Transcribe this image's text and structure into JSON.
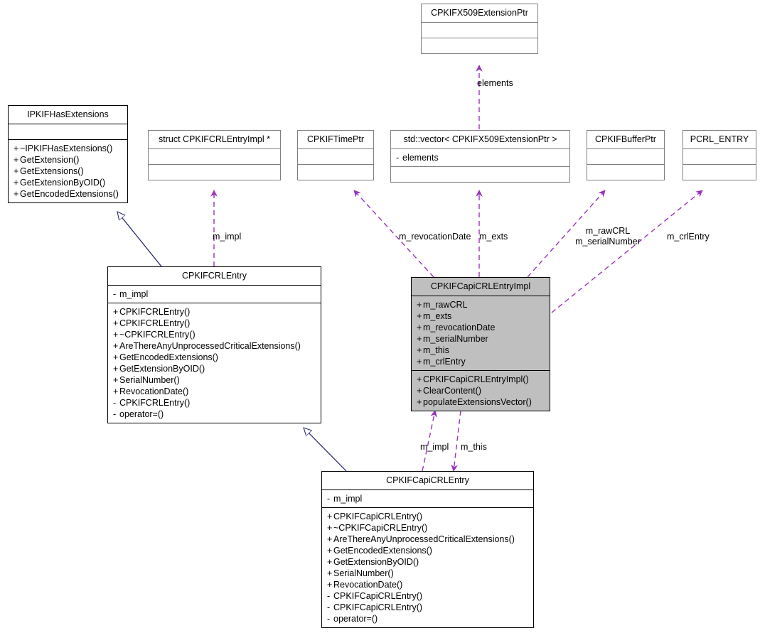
{
  "diagram": {
    "type": "uml-class-diagram",
    "colors": {
      "dependency_edge": "#9933bb",
      "inheritance_edge": "#191970",
      "highlight_fill": "#bfbfbf",
      "box_border": "#7f7f7f",
      "solid_border": "#000000",
      "background": "#ffffff"
    }
  },
  "classes": {
    "x509_extension_ptr": {
      "name": "CPKIFX509ExtensionPtr",
      "attributes": [],
      "operations": []
    },
    "ipkif_has_extensions": {
      "name": "IPKIFHasExtensions",
      "attributes": [],
      "operations": [
        {
          "vis": "+",
          "label": "~IPKIFHasExtensions()"
        },
        {
          "vis": "+",
          "label": "GetExtension()"
        },
        {
          "vis": "+",
          "label": "GetExtensions()"
        },
        {
          "vis": "+",
          "label": "GetExtensionByOID()"
        },
        {
          "vis": "+",
          "label": "GetEncodedExtensions()"
        }
      ]
    },
    "crl_entry_impl_struct": {
      "name": "struct CPKIFCRLEntryImpl *",
      "attributes": [],
      "operations": []
    },
    "time_ptr": {
      "name": "CPKIFTimePtr",
      "attributes": [],
      "operations": []
    },
    "vector_ext": {
      "name": "std::vector< CPKIFX509ExtensionPtr >",
      "attributes": [
        {
          "vis": "-",
          "label": "elements"
        }
      ],
      "operations": []
    },
    "buffer_ptr": {
      "name": "CPKIFBufferPtr",
      "attributes": [],
      "operations": []
    },
    "pcrl_entry": {
      "name": "PCRL_ENTRY",
      "attributes": [],
      "operations": []
    },
    "crl_entry": {
      "name": "CPKIFCRLEntry",
      "attributes": [
        {
          "vis": "-",
          "label": "m_impl"
        }
      ],
      "operations": [
        {
          "vis": "+",
          "label": "CPKIFCRLEntry()"
        },
        {
          "vis": "+",
          "label": "CPKIFCRLEntry()"
        },
        {
          "vis": "+",
          "label": "~CPKIFCRLEntry()"
        },
        {
          "vis": "+",
          "label": "AreThereAnyUnprocessedCriticalExtensions()"
        },
        {
          "vis": "+",
          "label": "GetEncodedExtensions()"
        },
        {
          "vis": "+",
          "label": "GetExtensionByOID()"
        },
        {
          "vis": "+",
          "label": "SerialNumber()"
        },
        {
          "vis": "+",
          "label": "RevocationDate()"
        },
        {
          "vis": "-",
          "label": "CPKIFCRLEntry()"
        },
        {
          "vis": "-",
          "label": "operator=()"
        }
      ]
    },
    "capi_crl_entry_impl": {
      "name": "CPKIFCapiCRLEntryImpl",
      "highlighted": true,
      "attributes": [
        {
          "vis": "+",
          "label": "m_rawCRL"
        },
        {
          "vis": "+",
          "label": "m_exts"
        },
        {
          "vis": "+",
          "label": "m_revocationDate"
        },
        {
          "vis": "+",
          "label": "m_serialNumber"
        },
        {
          "vis": "+",
          "label": "m_this"
        },
        {
          "vis": "+",
          "label": "m_crlEntry"
        }
      ],
      "operations": [
        {
          "vis": "+",
          "label": "CPKIFCapiCRLEntryImpl()"
        },
        {
          "vis": "+",
          "label": "ClearContent()"
        },
        {
          "vis": "+",
          "label": "populateExtensionsVector()"
        }
      ]
    },
    "capi_crl_entry": {
      "name": "CPKIFCapiCRLEntry",
      "attributes": [
        {
          "vis": "-",
          "label": "m_impl"
        }
      ],
      "operations": [
        {
          "vis": "+",
          "label": "CPKIFCapiCRLEntry()"
        },
        {
          "vis": "+",
          "label": "~CPKIFCapiCRLEntry()"
        },
        {
          "vis": "+",
          "label": "AreThereAnyUnprocessedCriticalExtensions()"
        },
        {
          "vis": "+",
          "label": "GetEncodedExtensions()"
        },
        {
          "vis": "+",
          "label": "GetExtensionByOID()"
        },
        {
          "vis": "+",
          "label": "SerialNumber()"
        },
        {
          "vis": "+",
          "label": "RevocationDate()"
        },
        {
          "vis": "-",
          "label": "CPKIFCapiCRLEntry()"
        },
        {
          "vis": "-",
          "label": "CPKIFCapiCRLEntry()"
        },
        {
          "vis": "-",
          "label": "operator=()"
        }
      ]
    }
  },
  "edge_labels": {
    "elements": "elements",
    "m_impl_crl_entry": "m_impl",
    "m_revocation_date": "m_revocationDate",
    "m_exts": "m_exts",
    "m_raw_crl": "m_rawCRL",
    "m_serial_number": "m_serialNumber",
    "m_crl_entry": "m_crlEntry",
    "m_impl_capi": "m_impl",
    "m_this": "m_this"
  }
}
